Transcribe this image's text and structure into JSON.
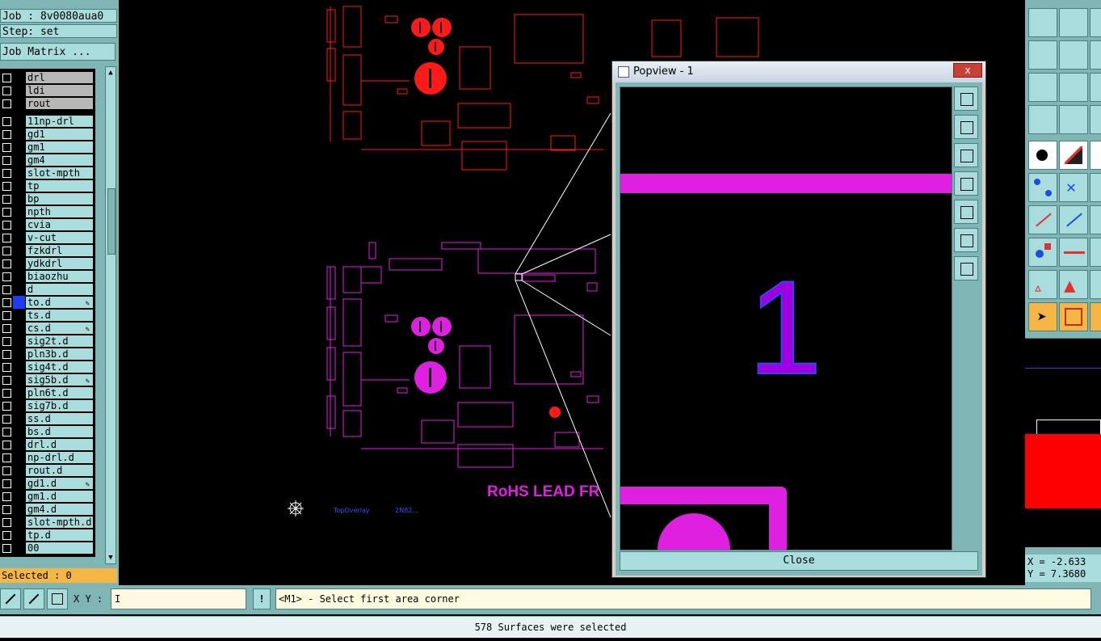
{
  "left": {
    "job": "Job : 8v0080aua0",
    "step": "Step: set",
    "matrix_button": "Job Matrix ...",
    "layers": [
      {
        "name": "drl",
        "gray": true
      },
      {
        "name": "ldi",
        "gray": true
      },
      {
        "name": "rout",
        "gray": true
      },
      {
        "name": "11np-drl"
      },
      {
        "name": "gd1"
      },
      {
        "name": "gm1"
      },
      {
        "name": "gm4"
      },
      {
        "name": "slot-mpth"
      },
      {
        "name": "tp"
      },
      {
        "name": "bp"
      },
      {
        "name": "npth"
      },
      {
        "name": "cvia"
      },
      {
        "name": "v-cut"
      },
      {
        "name": "fzkdrl"
      },
      {
        "name": "ydkdrl"
      },
      {
        "name": "biaozhu"
      },
      {
        "name": "d"
      },
      {
        "name": "to.d",
        "active": true,
        "editable": true
      },
      {
        "name": "ts.d"
      },
      {
        "name": "cs.d",
        "editable": true
      },
      {
        "name": "sig2t.d"
      },
      {
        "name": "pln3b.d"
      },
      {
        "name": "sig4t.d"
      },
      {
        "name": "sig5b.d",
        "editable": true
      },
      {
        "name": "pln6t.d"
      },
      {
        "name": "sig7b.d"
      },
      {
        "name": "ss.d"
      },
      {
        "name": "bs.d"
      },
      {
        "name": "drl.d"
      },
      {
        "name": "np-drl.d"
      },
      {
        "name": "rout.d"
      },
      {
        "name": "gd1.d",
        "editable": true
      },
      {
        "name": "gm1.d"
      },
      {
        "name": "gm4.d"
      },
      {
        "name": "slot-mpth.d"
      },
      {
        "name": "tp.d"
      },
      {
        "name": "00"
      }
    ],
    "selected": "Selected : 0"
  },
  "canvas": {
    "rohs_text": "RoHS LEAD FR",
    "overlay_label": "TopOverlay",
    "overlay_code": "2N82...",
    "top_board_color": "#ff1a1a",
    "bottom_board_color": "#e020e0"
  },
  "popview": {
    "title": "Popview - 1",
    "close_x": "x",
    "close_button": "Close",
    "glyph": "1"
  },
  "right": {
    "x_coord": "X = -2.633",
    "y_coord": "Y = 7.3680"
  },
  "bottom": {
    "xy_label": "X Y :",
    "xy_value": "I",
    "excl": "!",
    "prompt": "<M1> - Select first area corner"
  },
  "status": "578 Surfaces were selected"
}
